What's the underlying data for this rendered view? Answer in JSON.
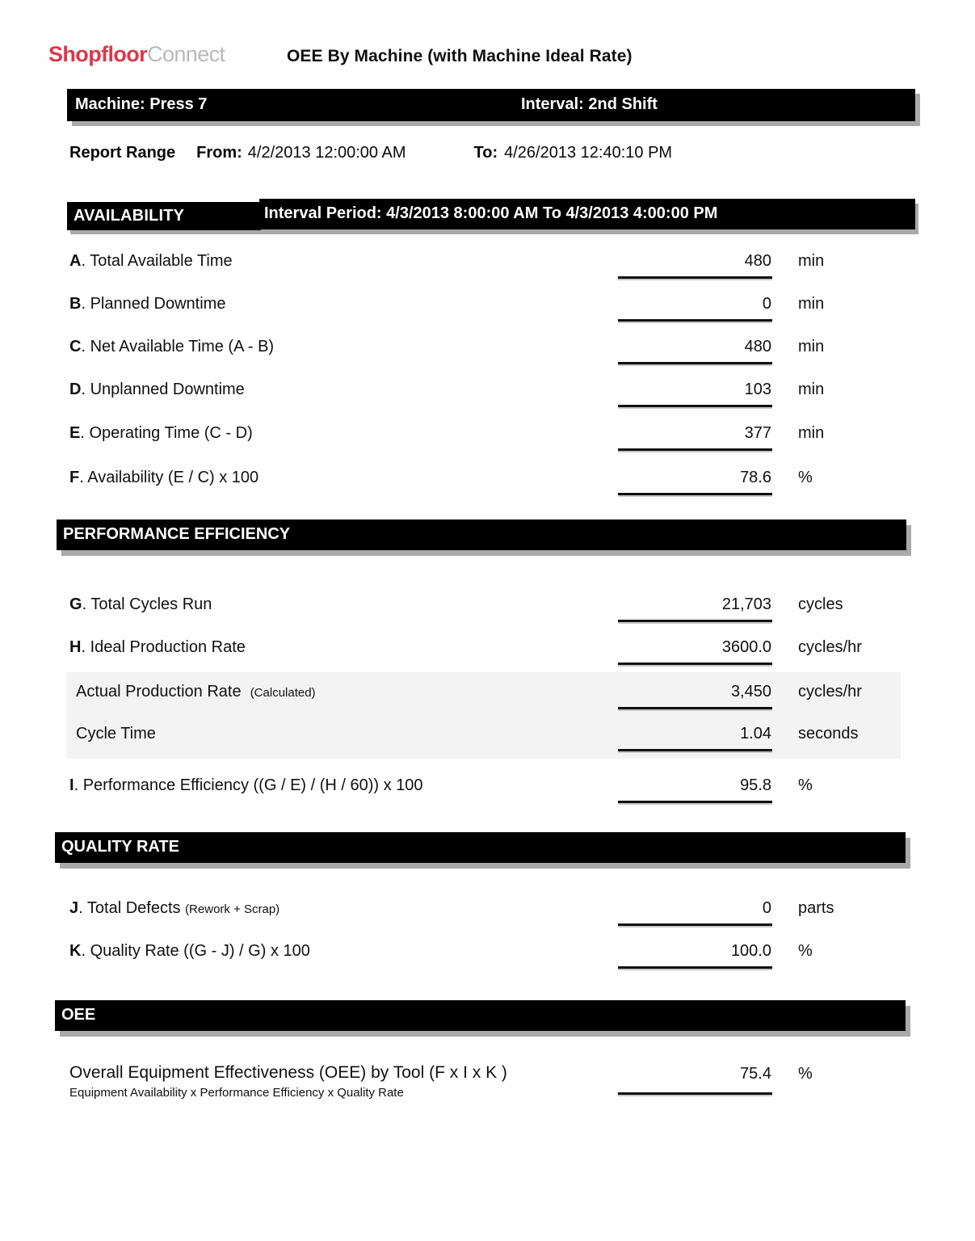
{
  "brand": {
    "logo_primary": "Shopfloor",
    "logo_secondary": "Connect"
  },
  "header": {
    "report_title": "OEE By Machine (with Machine Ideal Rate)",
    "machine_label": "Machine: Press 7",
    "interval_label": "Interval: 2nd Shift"
  },
  "report_range": {
    "title": "Report Range",
    "from_label": "From:",
    "from_value": "4/2/2013 12:00:00 AM",
    "to_label": "To:",
    "to_value": "4/26/2013 12:40:10 PM"
  },
  "sections": {
    "availability": {
      "heading": "AVAILABILITY",
      "interval_period": "Interval Period: 4/3/2013 8:00:00 AM  To  4/3/2013 4:00:00 PM",
      "rows": [
        {
          "key": "A",
          "label": "Total Available Time",
          "value": "480",
          "unit": "min"
        },
        {
          "key": "B",
          "label": "Planned Downtime",
          "value": "0",
          "unit": "min"
        },
        {
          "key": "C",
          "label": "Net Available Time (A - B)",
          "value": "480",
          "unit": "min"
        },
        {
          "key": "D",
          "label": "Unplanned Downtime",
          "value": "103",
          "unit": "min"
        },
        {
          "key": "E",
          "label": "Operating Time (C - D)",
          "value": "377",
          "unit": "min"
        },
        {
          "key": "F",
          "label": "Availability (E / C) x 100",
          "value": "78.6",
          "unit": "%"
        }
      ]
    },
    "performance": {
      "heading": "PERFORMANCE EFFICIENCY",
      "rows": [
        {
          "key": "G",
          "label": "Total Cycles Run",
          "value": "21,703",
          "unit": "cycles"
        },
        {
          "key": "H",
          "label": "Ideal Production Rate",
          "value": "3600.0",
          "unit": "cycles/hr"
        },
        {
          "key": "",
          "label": "Actual Production Rate",
          "note": "(Calculated)",
          "value": "3,450",
          "unit": "cycles/hr"
        },
        {
          "key": "",
          "label": "Cycle Time",
          "value": "1.04",
          "unit": "seconds"
        },
        {
          "key": "I",
          "label": "Performance Efficiency ((G / E) / (H / 60)) x 100",
          "value": "95.8",
          "unit": "%"
        }
      ]
    },
    "quality": {
      "heading": "QUALITY RATE",
      "rows": [
        {
          "key": "J",
          "label": "Total Defects",
          "note": "(Rework + Scrap)",
          "value": "0",
          "unit": "parts"
        },
        {
          "key": "K",
          "label": "Quality Rate ((G - J) / G) x 100",
          "value": "100.0",
          "unit": "%"
        }
      ]
    },
    "oee": {
      "heading": "OEE",
      "row": {
        "label": "Overall Equipment Effectiveness (OEE) by Tool  (F x I x K )",
        "sublabel": "Equipment Availability x Performance Efficiency x Quality Rate",
        "value": "75.4",
        "unit": "%"
      }
    }
  },
  "colors": {
    "brand_red": "#d9394a",
    "brand_gray": "#b9b9b9",
    "bar_background": "#000000",
    "bar_text": "#ffffff",
    "shadow": "#a9a9a9",
    "band_background": "#f3f3f3"
  }
}
